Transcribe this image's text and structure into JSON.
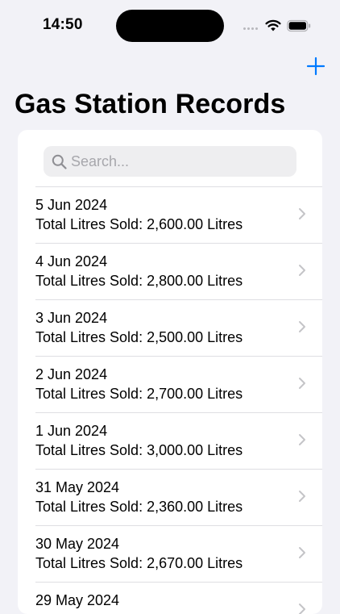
{
  "status_bar": {
    "time": "14:50"
  },
  "nav": {
    "title": "Gas Station Records",
    "add_icon": "plus-icon"
  },
  "search": {
    "placeholder": "Search...",
    "value": ""
  },
  "records": [
    {
      "date": "5 Jun 2024",
      "total_label": "Total Litres Sold: 2,600.00 Litres"
    },
    {
      "date": "4 Jun 2024",
      "total_label": "Total Litres Sold: 2,800.00 Litres"
    },
    {
      "date": "3 Jun 2024",
      "total_label": "Total Litres Sold: 2,500.00 Litres"
    },
    {
      "date": "2 Jun 2024",
      "total_label": "Total Litres Sold: 2,700.00 Litres"
    },
    {
      "date": "1 Jun 2024",
      "total_label": "Total Litres Sold: 3,000.00 Litres"
    },
    {
      "date": "31 May 2024",
      "total_label": "Total Litres Sold: 2,360.00 Litres"
    },
    {
      "date": "30 May 2024",
      "total_label": "Total Litres Sold: 2,670.00 Litres"
    },
    {
      "date": "29 May 2024",
      "total_label": ""
    }
  ],
  "colors": {
    "background": "#f2f2f7",
    "card": "#ffffff",
    "accent": "#007aff",
    "separator": "#dedee2",
    "secondary": "#a7a7ac",
    "chevron": "#c4c4c7"
  }
}
